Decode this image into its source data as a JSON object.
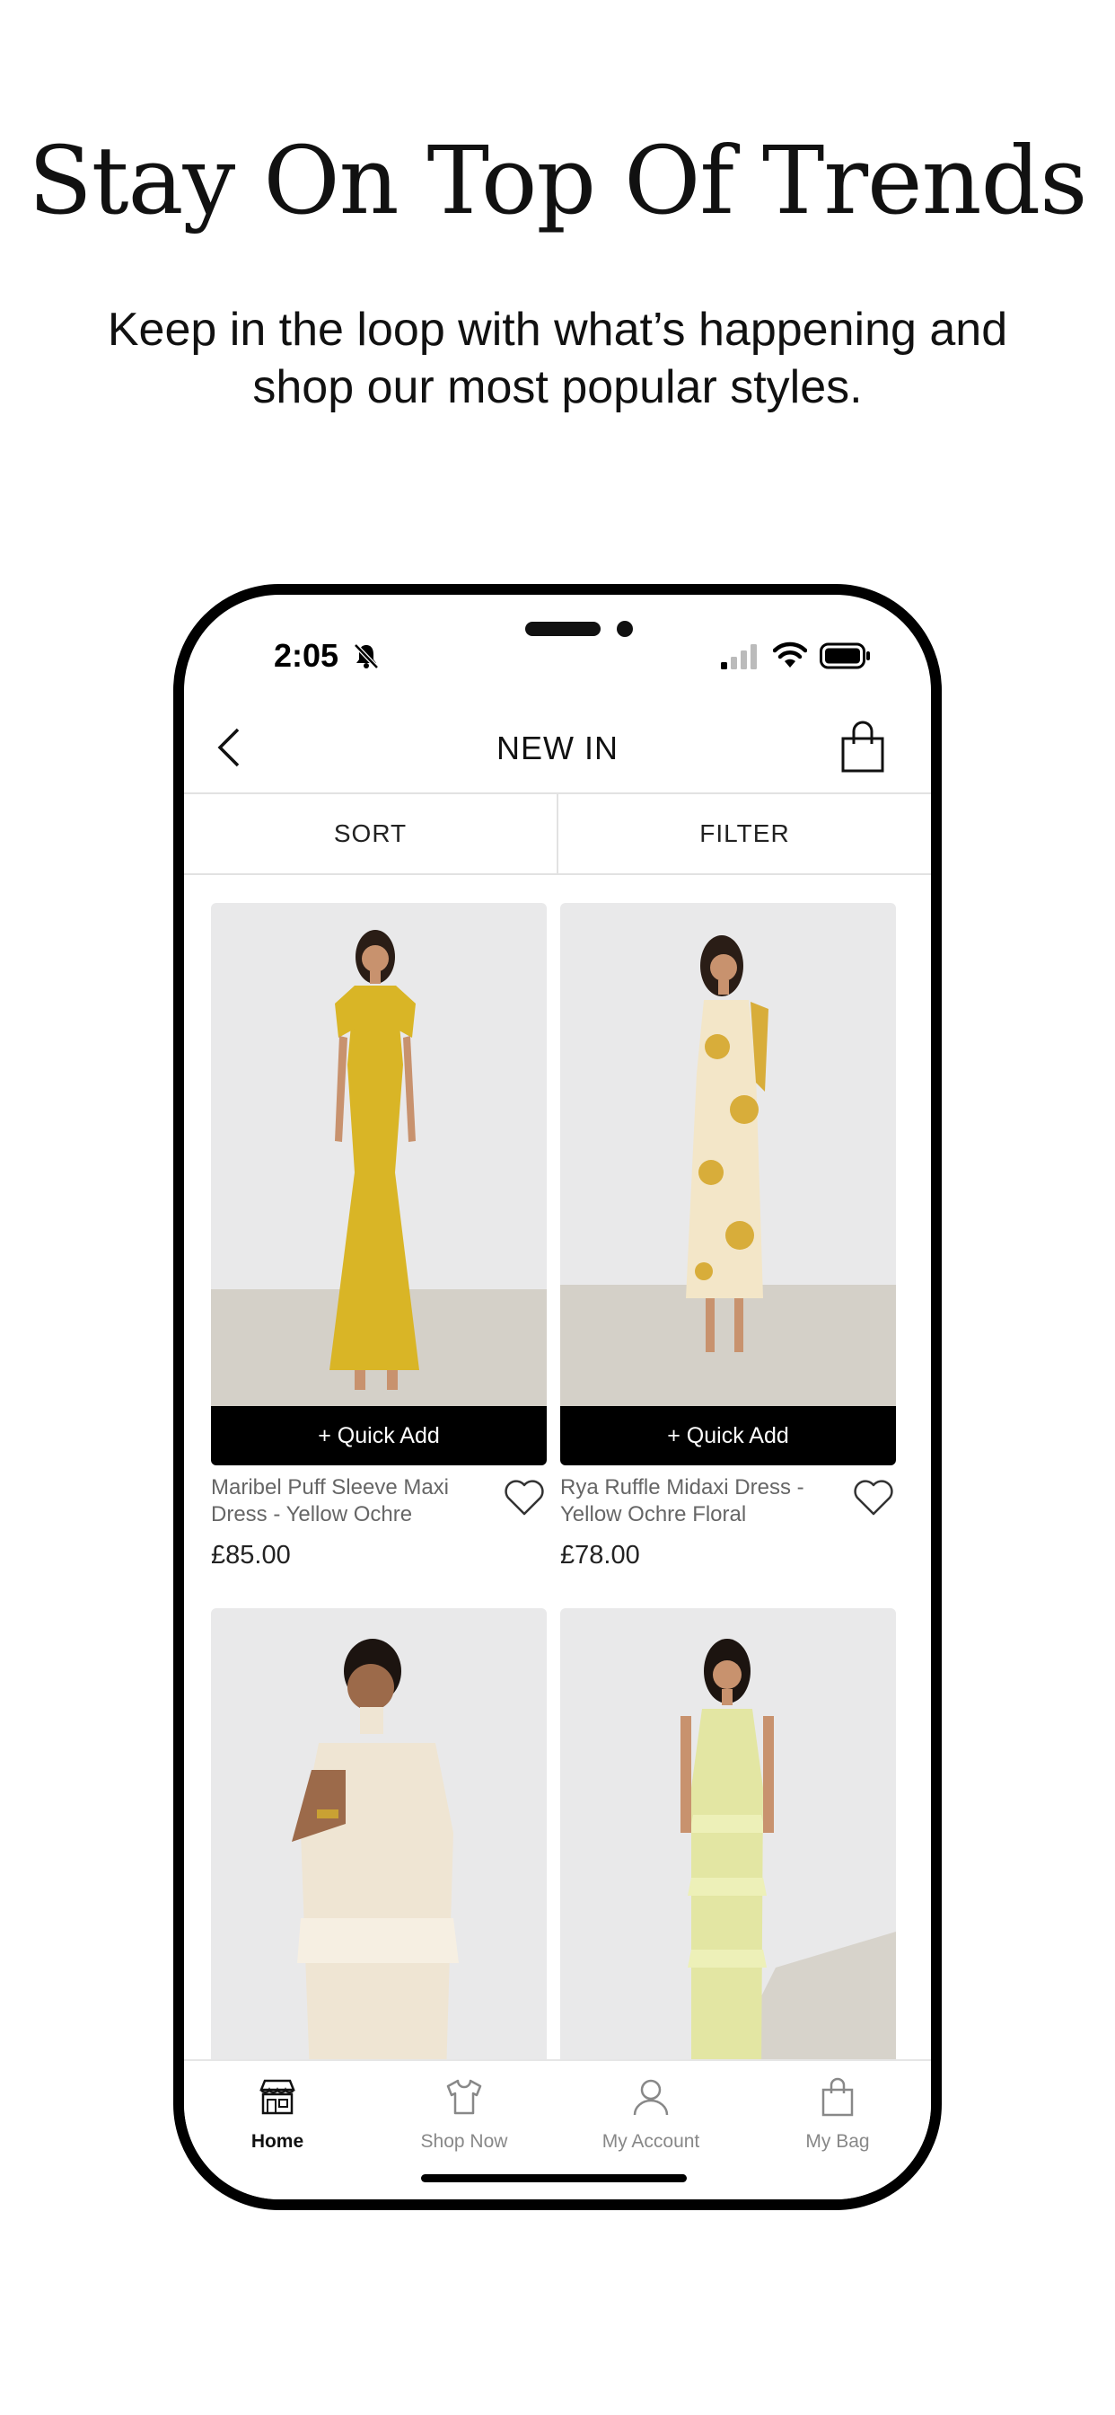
{
  "promo": {
    "headline": "Stay On Top Of Trends",
    "subline": "Keep in the loop with what’s happening and shop our most popular styles."
  },
  "status_bar": {
    "time": "2:05",
    "icons": [
      "bell-slash-icon",
      "signal-icon",
      "wifi-icon",
      "battery-icon"
    ]
  },
  "header": {
    "title": "NEW IN",
    "back_icon": "chevron-left-icon",
    "bag_icon": "shopping-bag-icon"
  },
  "sort_filter": {
    "sort_label": "SORT",
    "filter_label": "FILTER"
  },
  "products": [
    {
      "name": "Maribel Puff Sleeve Maxi Dress - Yellow Ochre",
      "price": "£85.00",
      "quick_add": "+ Quick Add",
      "dress_color": "#d9b526"
    },
    {
      "name": "Rya Ruffle Midaxi Dress - Yellow Ochre Floral",
      "price": "£78.00",
      "quick_add": "+ Quick Add",
      "dress_color": "#f3e6c8"
    },
    {
      "name": "",
      "price": "",
      "dress_color": "#efe5d3"
    },
    {
      "name": "",
      "price": "",
      "dress_color": "#e3e6a3"
    }
  ],
  "tabbar": {
    "items": [
      {
        "label": "Home",
        "icon": "storefront-icon",
        "active": true
      },
      {
        "label": "Shop Now",
        "icon": "tshirt-icon",
        "active": false
      },
      {
        "label": "My Account",
        "icon": "user-icon",
        "active": false
      },
      {
        "label": "My Bag",
        "icon": "shopping-bag-icon",
        "active": false
      }
    ]
  },
  "colors": {
    "background": "#ffffff",
    "text": "#111111",
    "quick_add_bg": "#000000",
    "photo_bg": "#e9e9ea",
    "floor": "#d4d0c8"
  }
}
